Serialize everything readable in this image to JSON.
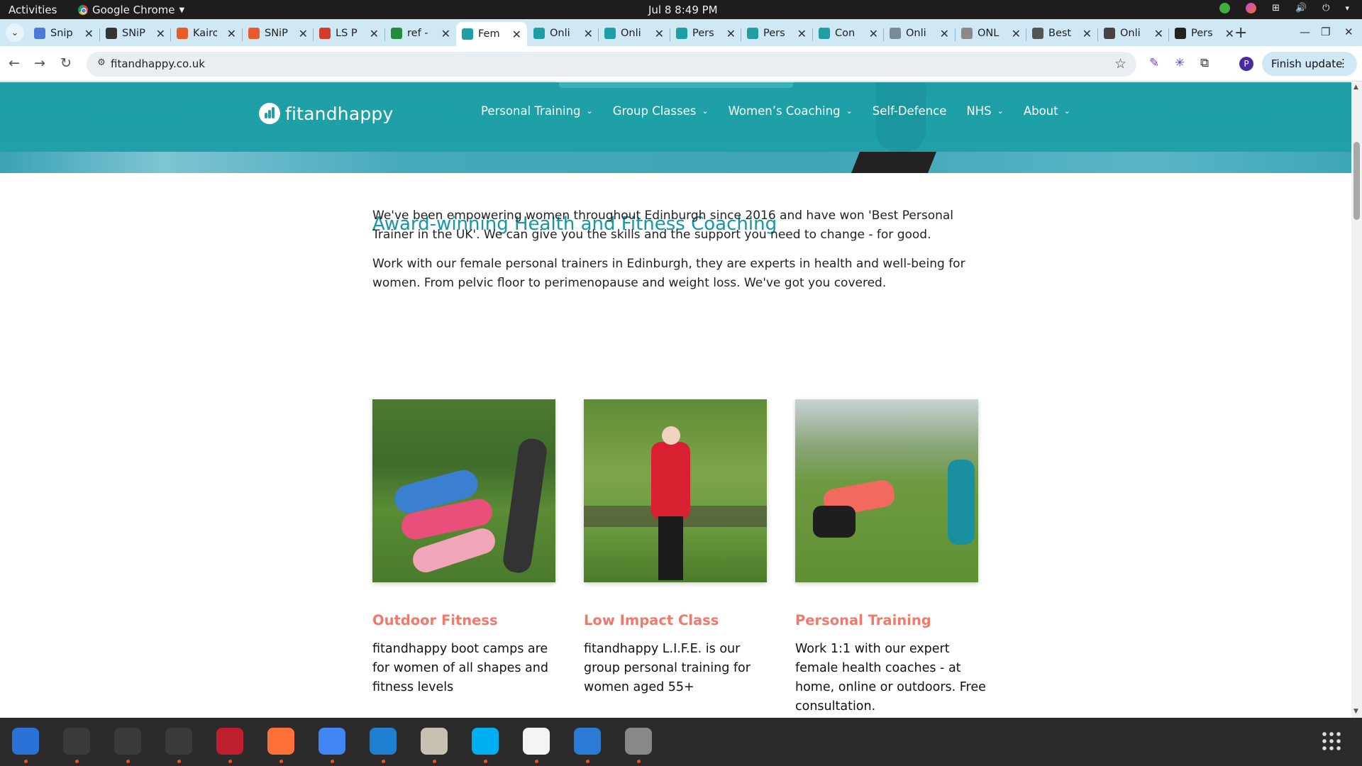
{
  "system": {
    "activities": "Activities",
    "app_menu": "Google Chrome",
    "clock": "Jul 8  8:49 PM"
  },
  "tabs": [
    {
      "label": "Snip",
      "favicon_color": "#4a7bd8",
      "active": false
    },
    {
      "label": "SNiP",
      "favicon_color": "#333333",
      "active": false
    },
    {
      "label": "Kairo",
      "favicon_color": "#e85a2a",
      "active": false
    },
    {
      "label": "SNiP",
      "favicon_color": "#e85a2a",
      "active": false
    },
    {
      "label": "LS P",
      "favicon_color": "#d63a2a",
      "active": false
    },
    {
      "label": "ref -",
      "favicon_color": "#1e8e3e",
      "active": false
    },
    {
      "label": "Fem",
      "favicon_color": "#1e9fa6",
      "active": true
    },
    {
      "label": "Onli",
      "favicon_color": "#1e9fa6",
      "active": false
    },
    {
      "label": "Onli",
      "favicon_color": "#1e9fa6",
      "active": false
    },
    {
      "label": "Pers",
      "favicon_color": "#1e9fa6",
      "active": false
    },
    {
      "label": "Pers",
      "favicon_color": "#1e9fa6",
      "active": false
    },
    {
      "label": "Con",
      "favicon_color": "#1e9fa6",
      "active": false
    },
    {
      "label": "Onli",
      "favicon_color": "#7a8a99",
      "active": false
    },
    {
      "label": "ONL",
      "favicon_color": "#8a8a8a",
      "active": false
    },
    {
      "label": "Best",
      "favicon_color": "#555555",
      "active": false
    },
    {
      "label": "Onli",
      "favicon_color": "#444444",
      "active": false
    },
    {
      "label": "Pers",
      "favicon_color": "#222222",
      "active": false
    }
  ],
  "toolbar": {
    "url": "fitandhappy.co.uk",
    "profile_initial": "P",
    "finish_update": "Finish update"
  },
  "site": {
    "logo_text": "fitandhappy",
    "nav": [
      {
        "label": "Personal Training",
        "dropdown": true
      },
      {
        "label": "Group Classes",
        "dropdown": true
      },
      {
        "label": "Women’s Coaching",
        "dropdown": true
      },
      {
        "label": "Self-Defence",
        "dropdown": false
      },
      {
        "label": "NHS",
        "dropdown": true
      },
      {
        "label": "About",
        "dropdown": true
      }
    ]
  },
  "main": {
    "headline": "Award-winning Health and Fitness Coaching",
    "paragraph1": "We've been empowering women throughout Edinburgh since 2016 and have won 'Best Personal Trainer in the UK'. We can give you the skills and the support you need to change - for good.",
    "paragraph2": "Work with our female personal trainers in Edinburgh, they are experts in health and well-being for women. From pelvic floor to perimenopause and weight loss. We've got you covered.",
    "cards": [
      {
        "title": "Outdoor Fitness",
        "description": "fitandhappy boot camps are for women of all shapes and fitness levels"
      },
      {
        "title": "Low Impact Class",
        "description": "fitandhappy L.I.F.E. is our group personal training for women aged 55+"
      },
      {
        "title": "Personal Training",
        "description": "Work 1:1 with our expert female health coaches - at home, online or outdoors. Free consultation."
      }
    ]
  },
  "colors": {
    "brand_teal": "#1e9fa6",
    "headline_teal": "#1797a6",
    "card_title_coral": "#ef7a6c"
  },
  "dock": [
    {
      "name": "thunderbird-icon",
      "color": "#2a72d8"
    },
    {
      "name": "terminal-icon",
      "color": "#3a3a3a"
    },
    {
      "name": "calculator-icon",
      "color": "#3a3a3a"
    },
    {
      "name": "system-monitor-icon",
      "color": "#3a3a3a"
    },
    {
      "name": "filezilla-icon",
      "color": "#bf1e2d"
    },
    {
      "name": "firefox-icon",
      "color": "#ff7139"
    },
    {
      "name": "chrome-icon",
      "color": "#4285f4"
    },
    {
      "name": "vscode-icon",
      "color": "#1f7fd0"
    },
    {
      "name": "files-icon",
      "color": "#c8c0b0"
    },
    {
      "name": "skype-icon",
      "color": "#00aff0"
    },
    {
      "name": "text-editor-icon",
      "color": "#f4f4f4"
    },
    {
      "name": "writer-icon",
      "color": "#2a7ad6"
    },
    {
      "name": "disk-icon",
      "color": "#888888"
    }
  ]
}
